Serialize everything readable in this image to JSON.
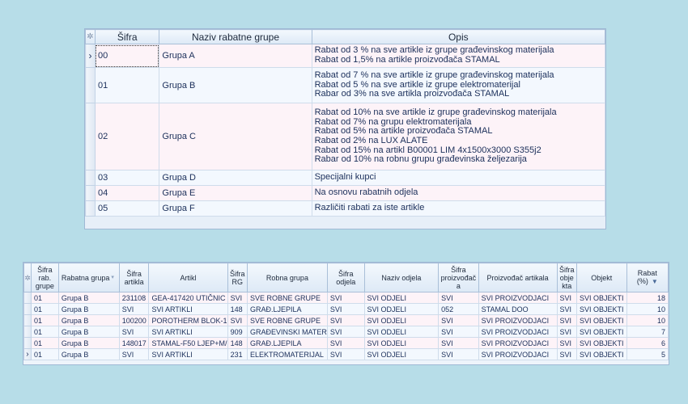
{
  "grid1": {
    "indicator_symbol": "✲",
    "current_row_symbol": "›",
    "headers": {
      "code": "Šifra",
      "name": "Naziv rabatne grupe",
      "desc": "Opis"
    },
    "rows": [
      {
        "code": "00",
        "name": "Grupa A",
        "desc": [
          "Rabat od 3 % na sve artikle iz grupe građevinskog materijala",
          "Rabat od 1,5% na artikle proizvođača STAMAL"
        ]
      },
      {
        "code": "01",
        "name": "Grupa B",
        "desc": [
          "Rabat od  7 % na sve artikle iz grupe građevinskog materijala",
          "Rabat od 5 % na sve artikle iz grupe elektromaterijal",
          "Rabar od 3% na sve artikla proizvođača STAMAL"
        ]
      },
      {
        "code": "02",
        "name": "Grupa C",
        "desc": [
          "Rabat od 10% na sve artikle iz grupe građevinskog materijala",
          "Rabat od 7% na grupu elektromaterijala",
          "Rabat od 5% na artikle proizvođača STAMAL",
          "Rabat od 2% na LUX ALATE",
          "Rabat od 15% na artikl B00001 LIM 4x1500x3000 S355j2",
          "Rabar od 10% na robnu grupu građevinska željezarija"
        ]
      },
      {
        "code": "03",
        "name": "Grupa D",
        "desc": [
          "Specijalni kupci"
        ]
      },
      {
        "code": "04",
        "name": "Grupa E",
        "desc": [
          "Na osnovu rabatnih odjela"
        ]
      },
      {
        "code": "05",
        "name": "Grupa F",
        "desc": [
          "Različiti rabati za iste artikle"
        ]
      }
    ]
  },
  "grid2": {
    "indicator_symbol": "✲",
    "current_row_symbol": "›",
    "sort_icon": "sort-descending-icon",
    "filter_icon": "filter-icon",
    "headers": {
      "sifra_rab_grupe": "Šifra rab. grupe",
      "rabatna_grupa": "Rabatna grupa",
      "sifra_artikla": "Šifra artikla",
      "artikl": "Artikl",
      "sifra_rg": "Šifra RG",
      "robna_grupa": "Robna grupa",
      "sifra_odjela": "Šifra odjela",
      "naziv_odjela": "Naziv odjela",
      "sifra_proizvodaca": "Šifra proizvođač a",
      "proizvodac": "Proizvođač artikala",
      "sifra_objekta": "Šifra obje kta",
      "objekt": "Objekt",
      "rabat": "Rabat (%)"
    },
    "rows": [
      [
        "01",
        "Grupa B",
        "231108",
        "GEA-417420 UTIČNIC",
        "SVI",
        "SVE ROBNE GRUPE",
        "SVI",
        "SVI ODJELI",
        "SVI",
        "SVI PROIZVODJACI",
        "SVI",
        "SVI OBJEKTI",
        "18"
      ],
      [
        "01",
        "Grupa B",
        "SVI",
        "SVI ARTIKLI",
        "148",
        "GRAĐ.LJEPILA",
        "SVI",
        "SVI ODJELI",
        "052",
        "STAMAL DOO",
        "SVI",
        "SVI OBJEKTI",
        "10"
      ],
      [
        "01",
        "Grupa B",
        "100200",
        "POROTHERM BLOK-1",
        "SVI",
        "SVE ROBNE GRUPE",
        "SVI",
        "SVI ODJELI",
        "SVI",
        "SVI PROIZVODJACI",
        "SVI",
        "SVI OBJEKTI",
        "10"
      ],
      [
        "01",
        "Grupa B",
        "SVI",
        "SVI ARTIKLI",
        "909",
        "GRAĐEVINSKI MATER",
        "SVI",
        "SVI ODJELI",
        "SVI",
        "SVI PROIZVODJACI",
        "SVI",
        "SVI OBJEKTI",
        "7"
      ],
      [
        "01",
        "Grupa B",
        "148017",
        "STAMAL-F50 LJEP+M/",
        "148",
        "GRAĐ.LJEPILA",
        "SVI",
        "SVI ODJELI",
        "SVI",
        "SVI PROIZVODJACI",
        "SVI",
        "SVI OBJEKTI",
        "6"
      ],
      [
        "01",
        "Grupa B",
        "SVI",
        "SVI ARTIKLI",
        "231",
        "ELEKTROMATERIJAL",
        "SVI",
        "SVI ODJELI",
        "SVI",
        "SVI PROIZVODJACI",
        "SVI",
        "SVI OBJEKTI",
        "5"
      ]
    ]
  }
}
